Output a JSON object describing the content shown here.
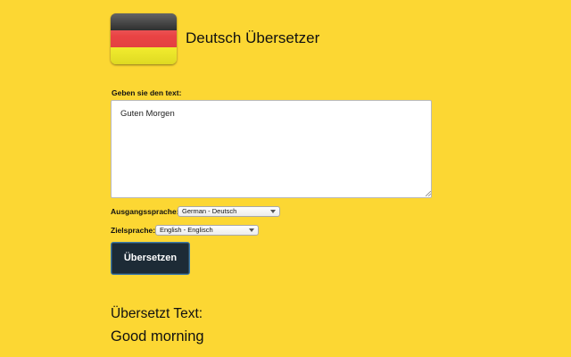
{
  "header": {
    "title": "Deutsch Übersetzer",
    "flag_icon": "german-flag-icon",
    "flag_colors": [
      "#000000",
      "#dd0000",
      "#ffce00"
    ]
  },
  "input": {
    "label": "Geben sie den text:",
    "value": "Guten Morgen"
  },
  "source_language": {
    "label": "Ausgangssprache:",
    "selected": "German - Deutsch"
  },
  "target_language": {
    "label": "Zielsprache:",
    "selected": "English - Englisch"
  },
  "translate_button": {
    "label": "Übersetzen",
    "color": "#1d2b36"
  },
  "result": {
    "heading": "Übersetzt Text:",
    "text": "Good morning"
  },
  "theme": {
    "background": "#fcd733"
  }
}
